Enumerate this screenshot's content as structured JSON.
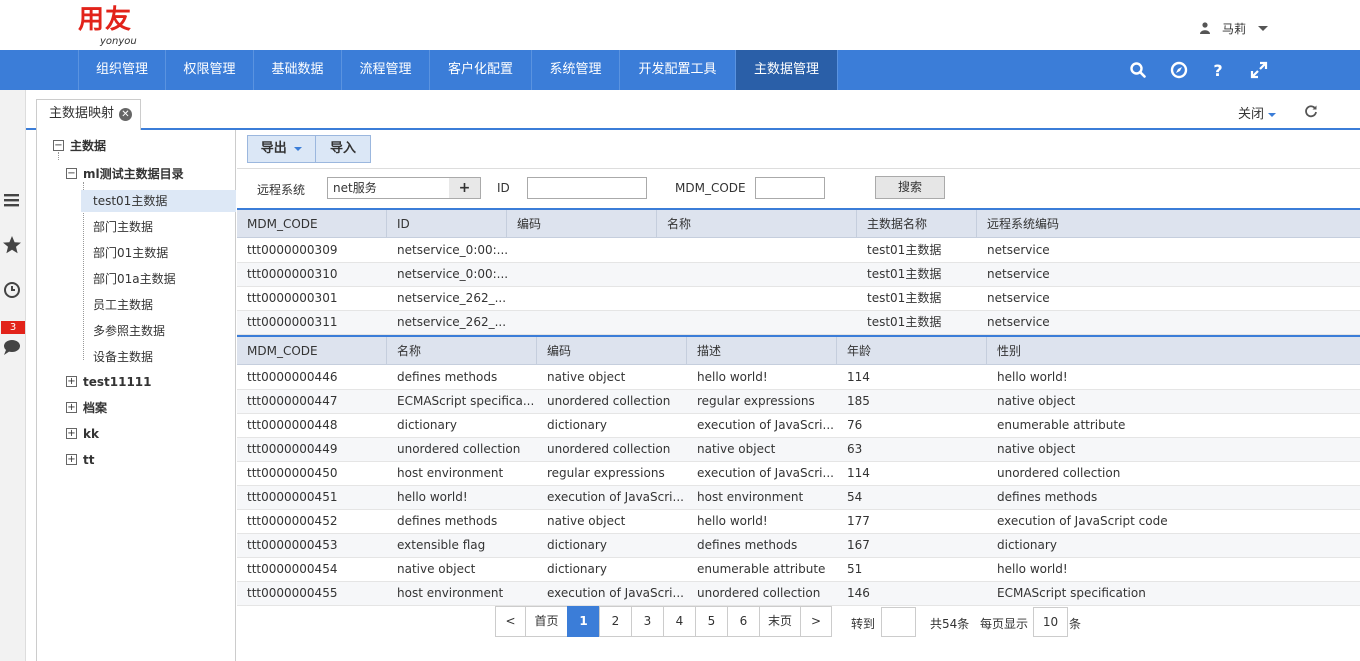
{
  "logo": {
    "cn": "用友",
    "en": "yonyou"
  },
  "user": {
    "name": "马莉"
  },
  "nav": {
    "items": [
      "组织管理",
      "权限管理",
      "基础数据",
      "流程管理",
      "客户化配置",
      "系统管理",
      "开发配置工具",
      "主数据管理"
    ],
    "active_index": 7
  },
  "leftbar": {
    "badge": "3"
  },
  "tabs": {
    "active_label": "主数据映射",
    "close_all": "关闭"
  },
  "tree": {
    "root": "主数据",
    "folder": "ml测试主数据目录",
    "children": [
      "test01主数据",
      "部门主数据",
      "部门01主数据",
      "部门01a主数据",
      "员工主数据",
      "多参照主数据",
      "设备主数据"
    ],
    "selected_index": 0,
    "others": [
      "test11111",
      "档案",
      "kk",
      "tt"
    ]
  },
  "toolbar": {
    "export_label": "导出",
    "import_label": "导入"
  },
  "search": {
    "remote_label": "远程系统",
    "remote_value": "net服务",
    "id_label": "ID",
    "id_value": "",
    "code_label": "MDM_CODE",
    "code_value": "",
    "search_label": "搜索"
  },
  "grid1": {
    "columns": [
      "MDM_CODE",
      "ID",
      "编码",
      "名称",
      "主数据名称",
      "远程系统编码"
    ],
    "rows": [
      [
        "ttt0000000309",
        "netservice_0:00:...",
        "",
        "",
        "test01主数据",
        "netservice"
      ],
      [
        "ttt0000000310",
        "netservice_0:00:...",
        "",
        "",
        "test01主数据",
        "netservice"
      ],
      [
        "ttt0000000301",
        "netservice_262_...",
        "",
        "",
        "test01主数据",
        "netservice"
      ],
      [
        "ttt0000000311",
        "netservice_262_...",
        "",
        "",
        "test01主数据",
        "netservice"
      ]
    ]
  },
  "grid2": {
    "columns": [
      "MDM_CODE",
      "名称",
      "编码",
      "描述",
      "年龄",
      "性别"
    ],
    "rows": [
      [
        "ttt0000000446",
        "defines methods",
        "native object",
        "hello world!",
        "114",
        "hello world!"
      ],
      [
        "ttt0000000447",
        "ECMAScript specifica...",
        "unordered collection",
        "regular expressions",
        "185",
        "native object"
      ],
      [
        "ttt0000000448",
        "dictionary",
        "dictionary",
        "execution of JavaScri...",
        "76",
        "enumerable attribute"
      ],
      [
        "ttt0000000449",
        "unordered collection",
        "unordered collection",
        "native object",
        "63",
        "native object"
      ],
      [
        "ttt0000000450",
        "host environment",
        "regular expressions",
        "execution of JavaScri...",
        "114",
        "unordered collection"
      ],
      [
        "ttt0000000451",
        "hello world!",
        "execution of JavaScri...",
        "host environment",
        "54",
        "defines methods"
      ],
      [
        "ttt0000000452",
        "defines methods",
        "native object",
        "hello world!",
        "177",
        "execution of JavaScript code"
      ],
      [
        "ttt0000000453",
        "extensible flag",
        "dictionary",
        "defines methods",
        "167",
        "dictionary"
      ],
      [
        "ttt0000000454",
        "native object",
        "dictionary",
        "enumerable attribute",
        "51",
        "hello world!"
      ],
      [
        "ttt0000000455",
        "host environment",
        "execution of JavaScri...",
        "unordered collection",
        "146",
        "ECMAScript specification"
      ]
    ]
  },
  "pager": {
    "prev": "<",
    "first": "首页",
    "pages": [
      "1",
      "2",
      "3",
      "4",
      "5",
      "6"
    ],
    "active_page": "1",
    "last": "末页",
    "next": ">",
    "goto_label": "转到",
    "goto_value": "",
    "total": "共54条",
    "per_page_label": "每页显示",
    "per_page_value": "10",
    "per_page_unit": "条"
  },
  "colors": {
    "nav_bg": "#3b7dd8",
    "nav_active": "#2a5fa8",
    "brand_red": "#e2231a"
  }
}
